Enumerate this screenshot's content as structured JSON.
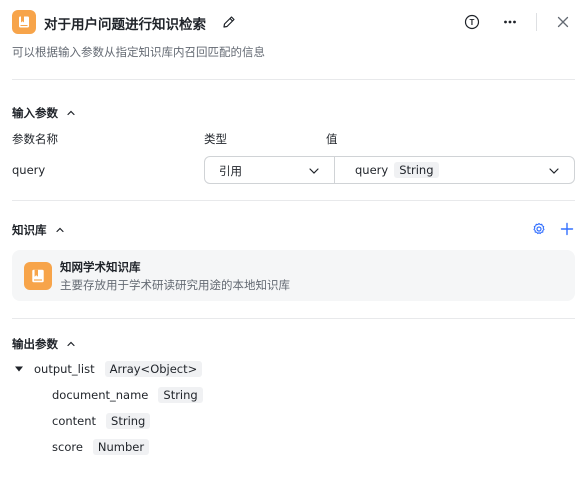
{
  "header": {
    "title": "对于用户问题进行知识检索",
    "description": "可以根据输入参数从指定知识库内召回匹配的信息",
    "t_icon": "T"
  },
  "input_section": {
    "title": "输入参数",
    "columns": {
      "name": "参数名称",
      "type": "类型",
      "value": "值"
    },
    "params": [
      {
        "name": "query",
        "type": "引用",
        "value": "query",
        "value_type": "String"
      }
    ]
  },
  "kb_section": {
    "title": "知识库",
    "items": [
      {
        "name": "知网学术知识库",
        "description": "主要存放用于学术研读研究用途的本地知识库"
      }
    ]
  },
  "output_section": {
    "title": "输出参数",
    "root": {
      "name": "output_list",
      "type": "Array<Object>"
    },
    "children": [
      {
        "name": "document_name",
        "type": "String"
      },
      {
        "name": "content",
        "type": "String"
      },
      {
        "name": "score",
        "type": "Number"
      }
    ]
  },
  "colors": {
    "accent": "#3370ff",
    "icon_orange": "#f7a44a",
    "muted_text": "#646a73"
  },
  "icons": [
    "book-icon",
    "edit-icon",
    "t-icon",
    "more-icon",
    "close-icon",
    "chevron-up-icon",
    "chevron-down-icon",
    "settings-icon",
    "plus-icon",
    "triangle-down-icon"
  ]
}
